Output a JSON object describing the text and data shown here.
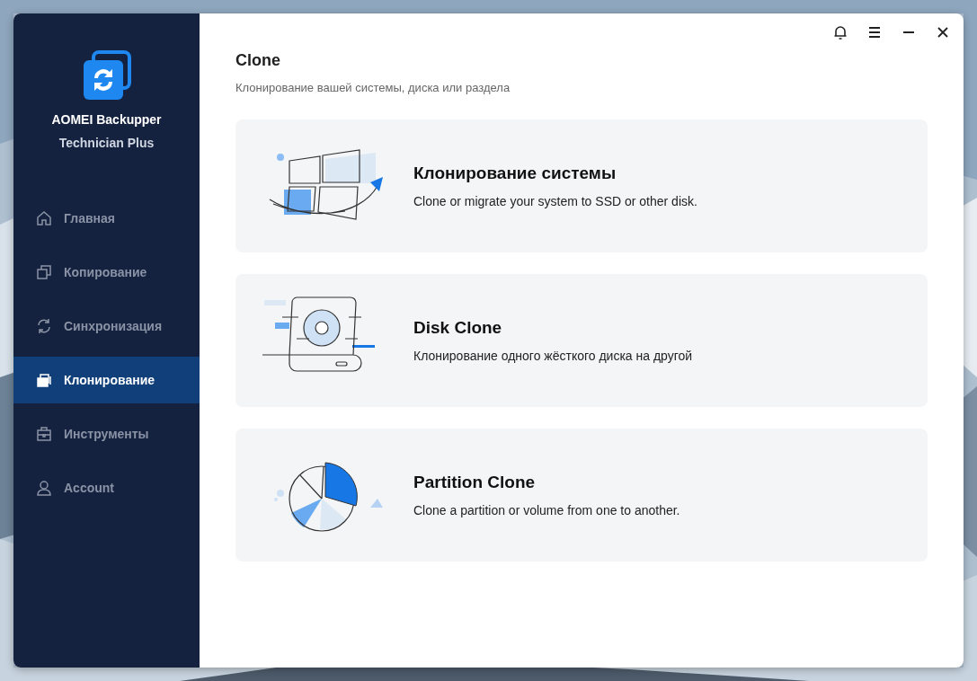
{
  "app": {
    "name": "AOMEI Backupper",
    "edition": "Technician Plus"
  },
  "nav": [
    {
      "label": "Главная",
      "kind": "home",
      "selected": false
    },
    {
      "label": "Копирование",
      "kind": "copy",
      "selected": false
    },
    {
      "label": "Синхронизация",
      "kind": "sync",
      "selected": false
    },
    {
      "label": "Клонирование",
      "kind": "clone",
      "selected": true
    },
    {
      "label": "Инструменты",
      "kind": "tools",
      "selected": false
    },
    {
      "label": "Account",
      "kind": "account",
      "selected": false
    }
  ],
  "page": {
    "title": "Clone",
    "subtitle": "Клонирование вашей системы, диска или раздела"
  },
  "cards": [
    {
      "kind": "system",
      "title": "Клонирование системы",
      "description": "Clone or migrate your system to SSD or other disk."
    },
    {
      "kind": "disk",
      "title": "Disk Clone",
      "description": "Клонирование одного жёсткого диска на другой"
    },
    {
      "kind": "partition",
      "title": "Partition Clone",
      "description": "Clone a partition or volume from one to another."
    }
  ]
}
